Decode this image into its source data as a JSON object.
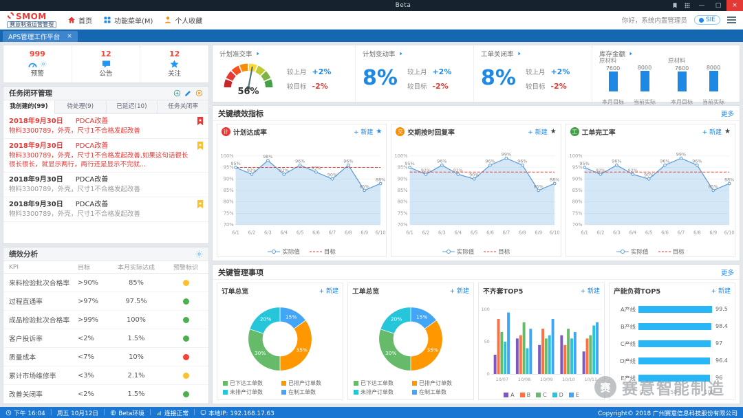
{
  "titlebar": {
    "center_label": "Beta"
  },
  "header": {
    "logo": "SMOM",
    "app_name": "赛意制造运营管理",
    "nav": [
      {
        "id": "home",
        "label": "首页"
      },
      {
        "id": "menu",
        "label": "功能菜单(M)"
      },
      {
        "id": "favorites",
        "label": "个人收藏"
      }
    ],
    "greeting": "你好，系统内置管理员",
    "lang": "SIE"
  },
  "tabbar": {
    "active_tab": "APS管理工作平台"
  },
  "sidebar": {
    "stats": [
      {
        "id": "alerts",
        "value": "999",
        "label": "预警",
        "icon": "gauge"
      },
      {
        "id": "announcements",
        "value": "12",
        "label": "公告",
        "icon": "chat"
      },
      {
        "id": "follows",
        "value": "12",
        "label": "关注",
        "icon": "star"
      }
    ],
    "tasks": {
      "title": "任务闭环管理",
      "tabs": [
        {
          "label": "我创建的(99)",
          "active": true
        },
        {
          "label": "待处理(9)",
          "active": false
        },
        {
          "label": "已延迟(10)",
          "active": false
        },
        {
          "label": "任务关闭率",
          "active": false
        }
      ],
      "items": [
        {
          "date": "2018年9月30日",
          "type": "PDCA改善",
          "desc": "物料3300789，外壳，尺寸1不合格发起改善",
          "urgent": true,
          "flag": "red"
        },
        {
          "date": "2018年9月30日",
          "type": "PDCA改善",
          "desc": "物料3300789，外壳，尺寸1不合格发起改善,如果这句话很长很长很长，就显示两行，两行还是显示不完就...",
          "urgent": true,
          "flag": "yellow"
        },
        {
          "date": "2018年9月30日",
          "type": "PDCA改善",
          "desc": "物料3300789，外壳，尺寸1不合格发起改善",
          "urgent": false,
          "flag": ""
        },
        {
          "date": "2018年9月30日",
          "type": "PDCA改善",
          "desc": "物料3300789，外壳，尺寸1不合格发起改善",
          "urgent": false,
          "flag": "yellow"
        }
      ]
    },
    "performance": {
      "title": "绩效分析",
      "headers": [
        "KPI",
        "目标",
        "本月实际达成",
        "预警标识"
      ],
      "rows": [
        {
          "name": "来料检验批次合格率",
          "target": ">90%",
          "actual": "85%",
          "status": "yellow"
        },
        {
          "name": "过程直通率",
          "target": ">97%",
          "actual": "97.5%",
          "status": "green"
        },
        {
          "name": "成品检验批次合格率",
          "target": ">99%",
          "actual": "100%",
          "status": "green"
        },
        {
          "name": "客户投诉率",
          "target": "<2%",
          "actual": "1.5%",
          "status": "green"
        },
        {
          "name": "质量成本",
          "target": "<7%",
          "actual": "10%",
          "status": "red"
        },
        {
          "name": "累计市场维修率",
          "target": "<3%",
          "actual": "2.1%",
          "status": "yellow"
        },
        {
          "name": "改善关闭率",
          "target": "<2%",
          "actual": "1.5%",
          "status": "green"
        }
      ]
    }
  },
  "overview": {
    "gauge": {
      "title": "计划准交率",
      "value": "56%",
      "gauge_pct": 56,
      "gauge_colors": [
        "#c62828",
        "#e53935",
        "#f4511e",
        "#fb8c00",
        "#fdd835",
        "#c0ca33",
        "#7cb342",
        "#43a047"
      ],
      "compare": [
        {
          "label": "较上月",
          "value": "+2%",
          "dir": "up"
        },
        {
          "label": "较目标",
          "value": "-2%",
          "dir": "down"
        }
      ]
    },
    "metrics": [
      {
        "title": "计划变动率",
        "value": "8%",
        "compare": [
          {
            "label": "较上月",
            "value": "+2%",
            "dir": "up"
          },
          {
            "label": "较目标",
            "value": "-2%",
            "dir": "down"
          }
        ]
      },
      {
        "title": "工单关闭率",
        "value": "8%",
        "compare": [
          {
            "label": "较上月",
            "value": "+2%",
            "dir": "up"
          },
          {
            "label": "较目标",
            "value": "-2%",
            "dir": "down"
          }
        ]
      }
    ],
    "inventory": {
      "title": "库存金额",
      "bar_color": "#1e88e5",
      "ymax": 8000,
      "groups": [
        {
          "name": "原材料",
          "bars": [
            {
              "label": "本月目标",
              "value": 7600
            },
            {
              "label": "当前实际",
              "value": 8000
            }
          ]
        },
        {
          "name": "原材料",
          "bars": [
            {
              "label": "本月目标",
              "value": 7600
            },
            {
              "label": "当前实际",
              "value": 8000
            }
          ]
        }
      ]
    }
  },
  "kpi_section": {
    "title": "关键绩效指标",
    "more": "更多",
    "new_label": "新建",
    "legend": {
      "actual": "实际值",
      "target": "目标"
    },
    "charts": [
      {
        "title": "计划达成率",
        "icon_color": "#e53935",
        "star_color": "#1e88e5",
        "x": [
          "6/1",
          "6/2",
          "6/3",
          "6/4",
          "6/5",
          "6/6",
          "6/7",
          "6/8",
          "6/9",
          "6/10"
        ],
        "values": [
          95,
          92,
          98,
          92,
          96,
          93,
          90,
          96,
          85,
          88
        ],
        "target": 95,
        "ylim": [
          70,
          100
        ]
      },
      {
        "title": "交期按时回复率",
        "icon_color": "#fb8c00",
        "star_color": "#37474f",
        "x": [
          "6/1",
          "6/2",
          "6/3",
          "6/4",
          "6/5",
          "6/6",
          "6/7",
          "6/8",
          "6/9",
          "6/10"
        ],
        "values": [
          95,
          92,
          96,
          92,
          90,
          96,
          99,
          96,
          85,
          88
        ],
        "target": 93,
        "ylim": [
          70,
          100
        ]
      },
      {
        "title": "工单完工率",
        "icon_color": "#43a047",
        "star_color": "#37474f",
        "x": [
          "6/1",
          "6/2",
          "6/3",
          "6/4",
          "6/5",
          "6/6",
          "6/7",
          "6/8",
          "6/9",
          "6/10"
        ],
        "values": [
          95,
          92,
          96,
          92,
          90,
          96,
          99,
          96,
          85,
          88
        ],
        "target": 93,
        "ylim": [
          70,
          100
        ]
      }
    ]
  },
  "mgmt_section": {
    "title": "关键管理事项",
    "more": "更多",
    "new_label": "新建",
    "panels": [
      {
        "type": "donut",
        "title": "订单总览",
        "slices": [
          {
            "label": "在制工单数",
            "pct": 15,
            "color": "#42a5f5"
          },
          {
            "label": "已排产订单数",
            "pct": 35,
            "color": "#ff9800"
          },
          {
            "label": "已下达工单数",
            "pct": 30,
            "color": "#66bb6a"
          },
          {
            "label": "未排产订单数",
            "pct": 20,
            "color": "#26c6da"
          }
        ],
        "legend": [
          {
            "label": "已下达工单数",
            "color": "#66bb6a"
          },
          {
            "label": "已排产订单数",
            "color": "#ff9800"
          },
          {
            "label": "未排产订单数",
            "color": "#26c6da"
          },
          {
            "label": "在制工单数",
            "color": "#42a5f5"
          }
        ]
      },
      {
        "type": "donut",
        "title": "工单总览",
        "slices": [
          {
            "label": "在制工单数",
            "pct": 15,
            "color": "#42a5f5"
          },
          {
            "label": "已排产订单数",
            "pct": 35,
            "color": "#ff9800"
          },
          {
            "label": "已下达工单数",
            "pct": 30,
            "color": "#66bb6a"
          },
          {
            "label": "未排产订单数",
            "pct": 20,
            "color": "#26c6da"
          }
        ],
        "legend": [
          {
            "label": "已下达工单数",
            "color": "#66bb6a"
          },
          {
            "label": "已排产订单数",
            "color": "#ff9800"
          },
          {
            "label": "未排产订单数",
            "color": "#26c6da"
          },
          {
            "label": "在制工单数",
            "color": "#42a5f5"
          }
        ]
      },
      {
        "type": "bars",
        "title": "不齐套TOP5",
        "categories": [
          "10/07",
          "10/08",
          "10/09",
          "10/10",
          "10/11"
        ],
        "ymax": 100,
        "yticks": [
          0,
          50,
          100
        ],
        "series": [
          {
            "name": "A",
            "color": "#7e57c2",
            "values": [
              30,
              55,
              45,
              60,
              35
            ]
          },
          {
            "name": "B",
            "color": "#ff7043",
            "values": [
              85,
              60,
              70,
              45,
              55
            ]
          },
          {
            "name": "C",
            "color": "#66bb6a",
            "values": [
              65,
              80,
              55,
              70,
              60
            ]
          },
          {
            "name": "D",
            "color": "#26c6da",
            "values": [
              50,
              40,
              60,
              55,
              75
            ]
          },
          {
            "name": "E",
            "color": "#42a5f5",
            "values": [
              95,
              70,
              85,
              65,
              80
            ]
          }
        ]
      },
      {
        "type": "hbars",
        "title": "产能负荷TOP5",
        "xmax": 100,
        "color": "#29b6f6",
        "bars": [
          {
            "label": "A产线",
            "value": 99.5
          },
          {
            "label": "B产线",
            "value": 98.4
          },
          {
            "label": "C产线",
            "value": 97
          },
          {
            "label": "D产线",
            "value": 96.4
          },
          {
            "label": "E产线",
            "value": 96
          }
        ]
      }
    ]
  },
  "statusbar": {
    "time": "下午 16:04",
    "date": "周五 10月12日",
    "env": "Beta环境",
    "conn": "连接正常",
    "ip": "本地IP: 192.168.17.63",
    "copyright": "Copyright© 2018 广州赛意信息科技股份有限公司"
  },
  "watermark": "赛意智能制造"
}
